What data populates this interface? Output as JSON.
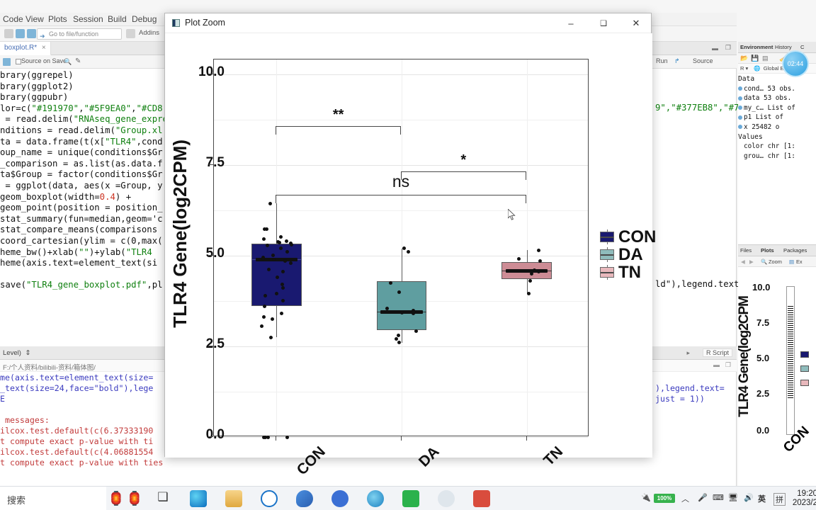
{
  "app": {
    "menu": [
      "Code",
      "View",
      "Plots",
      "Session",
      "Build",
      "Debug"
    ],
    "goto_placeholder": "Go to file/function",
    "addins_label": "Addins",
    "run_label": "Run",
    "source_label": "Source",
    "source_tab": "boxplot.R*",
    "source_on_save": "Source on Save",
    "console_level": "Level)",
    "console_path": "F:/个人资料/bilibili-资料/箱体图/",
    "r_script_label": "R Script"
  },
  "code_lines": [
    "brary(ggrepel)",
    "brary(ggplot2)",
    "brary(ggpubr)",
    "lor=c(\"#191970\",\"#5F9EA0\",\"#CD8",
    " = read.delim(\"RNAseq_gene_expre",
    "nditions = read.delim(\"Group.xl",
    "ta = data.frame(t(x[\"TLR4\",cond",
    "oup_name = unique(conditions$Gr",
    "_comparison = as.list(as.data.f",
    "ta$Group = factor(conditions$Gr",
    " = ggplot(data, aes(x =Group, y",
    "geom_boxplot(width=0.4) +",
    "geom_point(position = position_",
    "stat_summary(fun=median,geom='c",
    "stat_compare_means(comparisons",
    "coord_cartesian(ylim = c(0,max(",
    "heme_bw()+xlab(\"\")+ylab(\"TLR4",
    "heme(axis.text=element_text(si",
    "",
    "save(\"TLR4_gene_boxplot.pdf\",pl"
  ],
  "code_right_fragments": {
    "colors_tail": "9\",\"#377EB8\",\"#7",
    "legend_tail": "ld\"),legend.text"
  },
  "console_lines": [
    "me(axis.text=element_text(size=",
    "_text(size=24,face=\"bold\"),lege",
    "E",
    "",
    " messages:",
    "ilcox.test.default(c(6.37333190",
    "t compute exact p-value with ti",
    "ilcox.test.default(c(4.06881554",
    "t compute exact p-value with ties"
  ],
  "console_right_fragments": [
    "),legend.text= ",
    "just = 1))"
  ],
  "environment": {
    "tabs": [
      "Environment",
      "History",
      "C"
    ],
    "scope": "Global E",
    "clock_badge": "02:44",
    "sections": [
      {
        "title": "Data",
        "rows": [
          {
            "name": "cond…",
            "value": "53 obs."
          },
          {
            "name": "data",
            "value": "53 obs."
          },
          {
            "name": "my_c…",
            "value": "List of"
          },
          {
            "name": "p1",
            "value": "List of"
          },
          {
            "name": "x",
            "value": "25482 o"
          }
        ]
      },
      {
        "title": "Values",
        "rows": [
          {
            "name": "color",
            "value": "chr [1:"
          },
          {
            "name": "grou…",
            "value": "chr [1:"
          }
        ]
      }
    ]
  },
  "plots_pane": {
    "tabs": [
      "Files",
      "Plots",
      "Packages"
    ],
    "zoom_label": "Zoom",
    "export_label": "Ex",
    "ylabel": "TLR4 Gene(log2CPM",
    "yticks": [
      "10.0",
      "7.5",
      "5.0",
      "2.5",
      "0.0"
    ],
    "xtick": "CON"
  },
  "window": {
    "title": "Plot Zoom",
    "minimize": "–",
    "maximize": "❑",
    "close": "✕"
  },
  "taskbar": {
    "search_label": "搜索",
    "battery": "100%",
    "ime_label": "英",
    "ime_label2": "拼",
    "time": "19:20",
    "date": "2023/2"
  },
  "chart_data": {
    "type": "boxplot",
    "title": "",
    "xlabel": "",
    "ylabel": "TLR4 Gene(log2CPM)",
    "ylim": [
      0,
      10.4
    ],
    "yticks": [
      0.0,
      2.5,
      5.0,
      7.5,
      10.0
    ],
    "ytick_labels": [
      "0.0",
      "2.5",
      "5.0",
      "7.5",
      "10.0"
    ],
    "categories": [
      "CON",
      "DA",
      "TN"
    ],
    "grid": true,
    "legend_position": "right",
    "legend": [
      {
        "label": "CON",
        "color": "#191970"
      },
      {
        "label": "DA",
        "color": "#5F9EA0"
      },
      {
        "label": "TN",
        "color": "#CD8C95"
      }
    ],
    "boxes": [
      {
        "name": "CON",
        "color": "#191970",
        "lower_whisker": 2.75,
        "q1": 3.6,
        "median": 4.9,
        "q3": 5.33,
        "upper_whisker": 6.43,
        "points": [
          6.43,
          5.73,
          5.72,
          5.52,
          5.45,
          5.4,
          5.38,
          5.35,
          5.33,
          5.3,
          5.27,
          5.2,
          5.1,
          5.0,
          4.95,
          4.9,
          4.88,
          4.85,
          4.8,
          4.62,
          4.55,
          4.4,
          4.2,
          4.1,
          3.95,
          3.9,
          3.75,
          3.6,
          3.4,
          3.3,
          3.25,
          3.05,
          2.75,
          0.0,
          0.0,
          0.0,
          0.0
        ]
      },
      {
        "name": "DA",
        "color": "#5F9EA0",
        "lower_whisker": 2.6,
        "q1": 2.95,
        "median": 3.45,
        "q3": 4.3,
        "upper_whisker": 5.2,
        "points": [
          5.2,
          5.1,
          4.25,
          4.0,
          3.55,
          3.48,
          3.45,
          3.42,
          3.4,
          2.92,
          2.8,
          2.7,
          2.6
        ]
      },
      {
        "name": "TN",
        "color": "#CD8C95",
        "lower_whisker": 3.95,
        "q1": 4.35,
        "median": 4.58,
        "q3": 4.82,
        "upper_whisker": 5.15,
        "points": [
          5.15,
          4.9,
          4.85,
          4.6,
          4.55,
          4.5,
          4.3,
          3.95
        ]
      }
    ],
    "comparisons": [
      {
        "groups": [
          "CON",
          "DA"
        ],
        "label": "**",
        "y": 8.55
      },
      {
        "groups": [
          "DA",
          "TN"
        ],
        "label": "*",
        "y": 7.3
      },
      {
        "groups": [
          "CON",
          "TN"
        ],
        "label": "ns",
        "y": 6.65
      }
    ]
  }
}
